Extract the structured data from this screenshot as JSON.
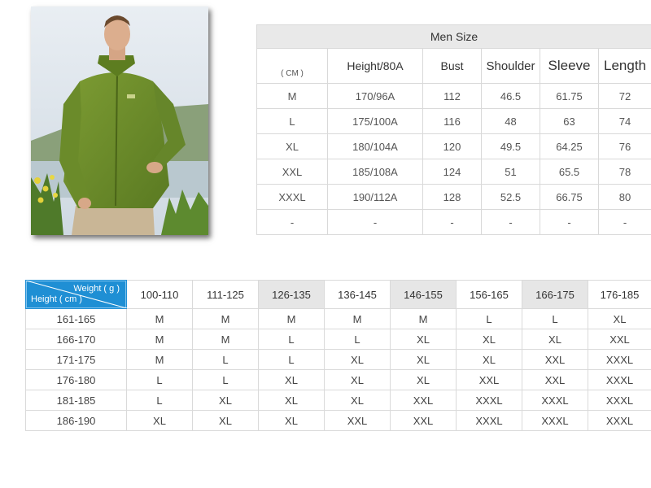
{
  "size_chart": {
    "title": "Men Size",
    "headers": [
      "( CM )",
      "Height/80A",
      "Bust",
      "Shoulder",
      "Sleeve",
      "Length"
    ],
    "rows": [
      [
        "M",
        "170/96A",
        "112",
        "46.5",
        "61.75",
        "72"
      ],
      [
        "L",
        "175/100A",
        "116",
        "48",
        "63",
        "74"
      ],
      [
        "XL",
        "180/104A",
        "120",
        "49.5",
        "64.25",
        "76"
      ],
      [
        "XXL",
        "185/108A",
        "124",
        "51",
        "65.5",
        "78"
      ],
      [
        "XXXL",
        "190/112A",
        "128",
        "52.5",
        "66.75",
        "80"
      ],
      [
        "-",
        "-",
        "-",
        "-",
        "-",
        "-"
      ]
    ]
  },
  "weight_height_chart": {
    "corner_weight": "Weight ( g )",
    "corner_height": "Height ( cm )",
    "weight_headers": [
      "100-110",
      "111-125",
      "126-135",
      "136-145",
      "146-155",
      "156-165",
      "166-175",
      "176-185"
    ],
    "rows": [
      {
        "height": "161-165",
        "sizes": [
          "M",
          "M",
          "M",
          "M",
          "M",
          "L",
          "L",
          "XL"
        ]
      },
      {
        "height": "166-170",
        "sizes": [
          "M",
          "M",
          "L",
          "L",
          "XL",
          "XL",
          "XL",
          "XXL"
        ]
      },
      {
        "height": "171-175",
        "sizes": [
          "M",
          "L",
          "L",
          "XL",
          "XL",
          "XL",
          "XXL",
          "XXXL"
        ]
      },
      {
        "height": "176-180",
        "sizes": [
          "L",
          "L",
          "XL",
          "XL",
          "XL",
          "XXL",
          "XXL",
          "XXXL"
        ]
      },
      {
        "height": "181-185",
        "sizes": [
          "L",
          "XL",
          "XL",
          "XL",
          "XXL",
          "XXXL",
          "XXXL",
          "XXXL"
        ]
      },
      {
        "height": "186-190",
        "sizes": [
          "XL",
          "XL",
          "XL",
          "XXL",
          "XXL",
          "XXXL",
          "XXXL",
          "XXXL"
        ]
      }
    ]
  },
  "colors": {
    "corner_blue": "#1f8fd4",
    "header_gray": "#e6e6e6",
    "jacket_green": "#6f8f2c"
  }
}
